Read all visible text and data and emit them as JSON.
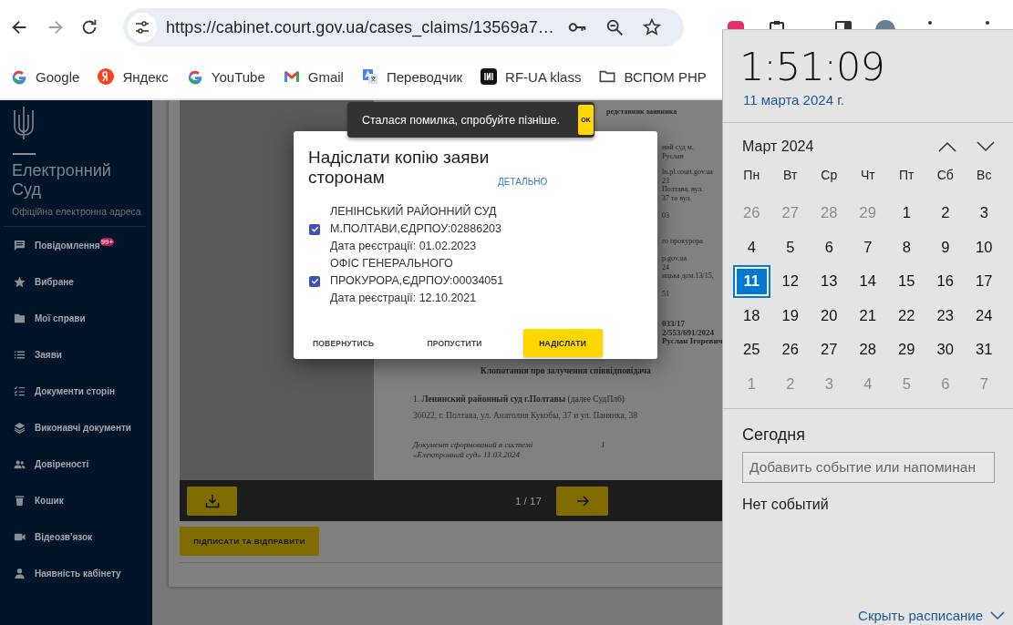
{
  "browser": {
    "nav": [
      {
        "kind": "back",
        "disabled": false
      },
      {
        "kind": "forward",
        "disabled": true
      },
      {
        "kind": "reload",
        "disabled": false
      }
    ],
    "url": "https://cabinet.court.gov.ua/cases_claims/13569a7…",
    "bookmarks": [
      {
        "kind": "google",
        "label": "Google"
      },
      {
        "kind": "yandex",
        "label": "Яндекс"
      },
      {
        "kind": "google",
        "label": "YouTube"
      },
      {
        "kind": "gmail",
        "label": "Gmail"
      },
      {
        "kind": "translate",
        "label": "Переводчик"
      },
      {
        "kind": "rfua",
        "label": "RF-UA klass"
      },
      {
        "kind": "folder",
        "label": "ВСПОМ PHP"
      }
    ]
  },
  "sidebar": {
    "title": "Електронний Суд",
    "subtitle": "Офіційна електронна адреса",
    "items": [
      {
        "kind": "message",
        "label": "Повідомлення",
        "badge": "99+"
      },
      {
        "kind": "star",
        "label": "Вибране"
      },
      {
        "kind": "folder",
        "label": "Мої справи"
      },
      {
        "kind": "list",
        "label": "Заяви"
      },
      {
        "kind": "checklist",
        "label": "Документи сторін"
      },
      {
        "kind": "layers",
        "label": "Виконавчі документи"
      },
      {
        "kind": "people",
        "label": "Довіреності"
      },
      {
        "kind": "trash",
        "label": "Кошик"
      },
      {
        "kind": "video",
        "label": "Відеозв'язок"
      },
      {
        "kind": "person",
        "label": "Наявність кабінету"
      }
    ]
  },
  "viewer": {
    "header": "редставник заявника",
    "fragments": [
      {
        "bold": false,
        "lines": [
          "ний суд м.",
          "Руслан"
        ]
      },
      {
        "bold": false,
        "lines": [
          "ln.pl.court.gov.ua",
          "23",
          "Полтава, вул.",
          "37 та вул."
        ]
      },
      {
        "bold": false,
        "lines": [
          "03"
        ]
      },
      {
        "bold": false,
        "lines": [
          "го прокурора"
        ]
      },
      {
        "bold": false,
        "lines": [
          "p.gov.ua",
          "24",
          "ицька дом.13/15,"
        ]
      },
      {
        "bold": false,
        "lines": [
          "51"
        ]
      },
      {
        "bold": true,
        "lines": [
          "033/17",
          "2/553/691/2024",
          "Руслан Ігоревич"
        ]
      }
    ],
    "heading": "Клопотання про залучення співвідповідача",
    "party": "1. **Ленинский районный суд г.Полтавы** (далее СудПл6)",
    "address": "36022, г. Полтава, ул. Анатолия Кукобы, 37 и ул. Панянка, 38",
    "footer": "Документ сформований в системі «Електронний суд» 11.03.2024",
    "page_number": "1",
    "pager": "1 / 17"
  },
  "sign_button": "ПІДПИСАТИ ТА ВІДПРАВИТИ",
  "snackbar": {
    "message": "Сталася помилка, спробуйте пізніше.",
    "action": "OK"
  },
  "dialog": {
    "title": "Надіслати копію заяви сторонам",
    "details_link": "ДЕТАЛЬНО",
    "recipients": [
      {
        "name": "ЛЕНІНСЬКИЙ РАЙОННИЙ СУД М.ПОЛТАВИ,ЄДРПОУ:02886203",
        "registered": "Дата реєстрації: 01.02.2023",
        "checked": true
      },
      {
        "name": "ОФІС ГЕНЕРАЛЬНОГО ПРОКУРОРА,ЄДРПОУ:00034051",
        "registered": "Дата реєстрації: 12.10.2021",
        "checked": true
      }
    ],
    "buttons": [
      {
        "kind": "text",
        "label": "ПОВЕРНУТИСЬ"
      },
      {
        "kind": "text",
        "label": "ПРОПУСТИТИ"
      },
      {
        "kind": "primary",
        "label": "НАДІСЛАТИ"
      }
    ]
  },
  "calendar": {
    "time": "1:51:09",
    "date": "11 марта 2024 г.",
    "month": "Март 2024",
    "weekdays": [
      "Пн",
      "Вт",
      "Ср",
      "Чт",
      "Пт",
      "Сб",
      "Вс"
    ],
    "days": [
      {
        "label": "26",
        "in_month": false,
        "selected": false
      },
      {
        "label": "27",
        "in_month": false,
        "selected": false
      },
      {
        "label": "28",
        "in_month": false,
        "selected": false
      },
      {
        "label": "29",
        "in_month": false,
        "selected": false
      },
      {
        "label": "1",
        "in_month": true,
        "selected": false
      },
      {
        "label": "2",
        "in_month": true,
        "selected": false
      },
      {
        "label": "3",
        "in_month": true,
        "selected": false
      },
      {
        "label": "4",
        "in_month": true,
        "selected": false
      },
      {
        "label": "5",
        "in_month": true,
        "selected": false
      },
      {
        "label": "6",
        "in_month": true,
        "selected": false
      },
      {
        "label": "7",
        "in_month": true,
        "selected": false
      },
      {
        "label": "8",
        "in_month": true,
        "selected": false
      },
      {
        "label": "9",
        "in_month": true,
        "selected": false
      },
      {
        "label": "10",
        "in_month": true,
        "selected": false
      },
      {
        "label": "11",
        "in_month": true,
        "selected": true
      },
      {
        "label": "12",
        "in_month": true,
        "selected": false
      },
      {
        "label": "13",
        "in_month": true,
        "selected": false
      },
      {
        "label": "14",
        "in_month": true,
        "selected": false
      },
      {
        "label": "15",
        "in_month": true,
        "selected": false
      },
      {
        "label": "16",
        "in_month": true,
        "selected": false
      },
      {
        "label": "17",
        "in_month": true,
        "selected": false
      },
      {
        "label": "18",
        "in_month": true,
        "selected": false
      },
      {
        "label": "19",
        "in_month": true,
        "selected": false
      },
      {
        "label": "20",
        "in_month": true,
        "selected": false
      },
      {
        "label": "21",
        "in_month": true,
        "selected": false
      },
      {
        "label": "22",
        "in_month": true,
        "selected": false
      },
      {
        "label": "23",
        "in_month": true,
        "selected": false
      },
      {
        "label": "24",
        "in_month": true,
        "selected": false
      },
      {
        "label": "25",
        "in_month": true,
        "selected": false
      },
      {
        "label": "26",
        "in_month": true,
        "selected": false
      },
      {
        "label": "27",
        "in_month": true,
        "selected": false
      },
      {
        "label": "28",
        "in_month": true,
        "selected": false
      },
      {
        "label": "29",
        "in_month": true,
        "selected": false
      },
      {
        "label": "30",
        "in_month": true,
        "selected": false
      },
      {
        "label": "31",
        "in_month": true,
        "selected": false
      },
      {
        "label": "1",
        "in_month": false,
        "selected": false
      },
      {
        "label": "2",
        "in_month": false,
        "selected": false
      },
      {
        "label": "3",
        "in_month": false,
        "selected": false
      },
      {
        "label": "4",
        "in_month": false,
        "selected": false
      },
      {
        "label": "5",
        "in_month": false,
        "selected": false
      },
      {
        "label": "6",
        "in_month": false,
        "selected": false
      },
      {
        "label": "7",
        "in_month": false,
        "selected": false
      }
    ],
    "today_heading": "Сегодня",
    "event_placeholder": "Добавить событие или напоминан",
    "no_events": "Нет событий",
    "hide_link": "Скрыть расписание"
  }
}
